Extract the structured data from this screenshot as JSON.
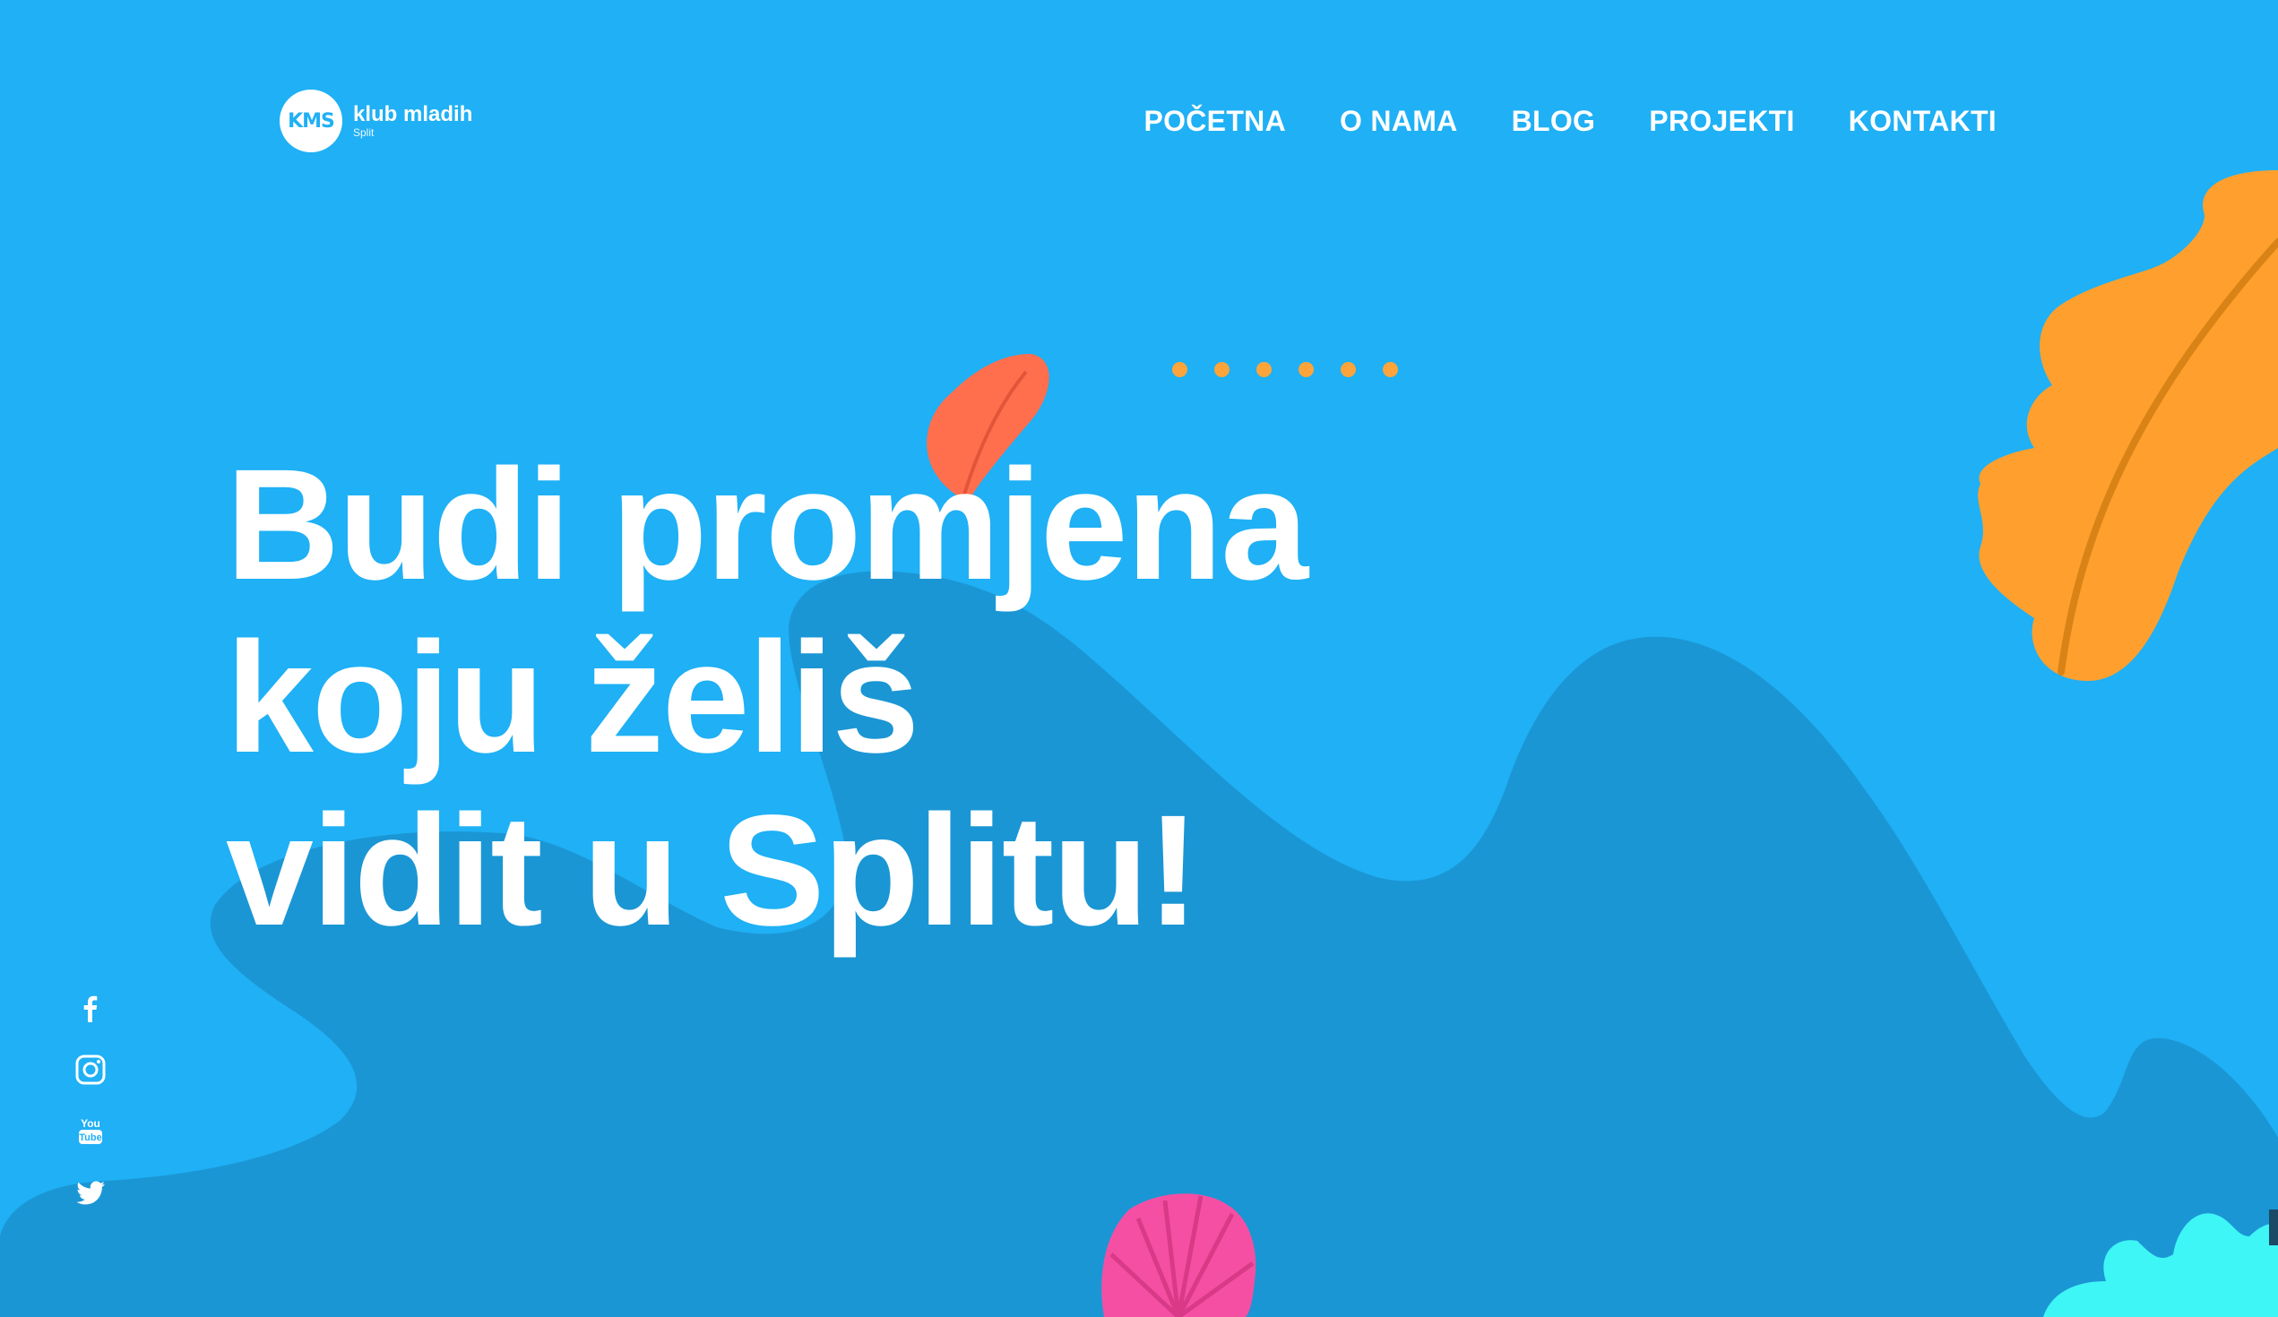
{
  "brand": {
    "badge": "KMS",
    "name": "klub mladih",
    "city": "Split"
  },
  "nav": {
    "items": [
      {
        "label": "POČETNA"
      },
      {
        "label": "O NAMA"
      },
      {
        "label": "BLOG"
      },
      {
        "label": "PROJEKTI"
      },
      {
        "label": "KONTAKTI"
      }
    ]
  },
  "hero": {
    "line1": "Budi promjena",
    "line2": "koju želiš",
    "line3": "vidit u Splitu!"
  },
  "slider": {
    "dots_count": 6
  },
  "social": {
    "icons": [
      "facebook-icon",
      "instagram-icon",
      "youtube-icon",
      "twitter-icon"
    ]
  },
  "colors": {
    "background": "#1fb0f5",
    "wave": "#1b96d4",
    "accent_orange": "#ffa02e",
    "accent_coral": "#ff6f4e",
    "accent_pink": "#f54fa4",
    "accent_cyan": "#3ef6f6",
    "text": "#ffffff"
  }
}
